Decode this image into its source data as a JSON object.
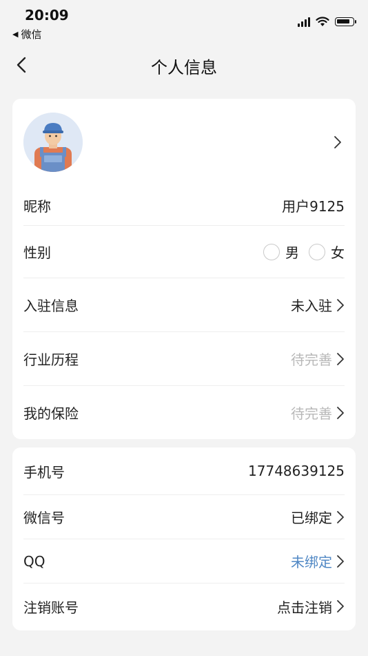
{
  "status": {
    "time": "20:09",
    "back_app": "微信"
  },
  "header": {
    "title": "个人信息"
  },
  "profile": {
    "nickname_label": "昵称",
    "nickname_value": "用户9125",
    "gender_label": "性别",
    "gender_male": "男",
    "gender_female": "女",
    "settle_label": "入驻信息",
    "settle_value": "未入驻",
    "history_label": "行业历程",
    "history_value": "待完善",
    "insurance_label": "我的保险",
    "insurance_value": "待完善"
  },
  "account": {
    "phone_label": "手机号",
    "phone_value": "17748639125",
    "wechat_label": "微信号",
    "wechat_value": "已绑定",
    "qq_label": "QQ",
    "qq_value": "未绑定",
    "cancel_label": "注销账号",
    "cancel_value": "点击注销"
  },
  "colors": {
    "background": "#f3f3f3",
    "card": "#ffffff",
    "muted": "#b8b8b8",
    "link": "#4f87c4"
  }
}
